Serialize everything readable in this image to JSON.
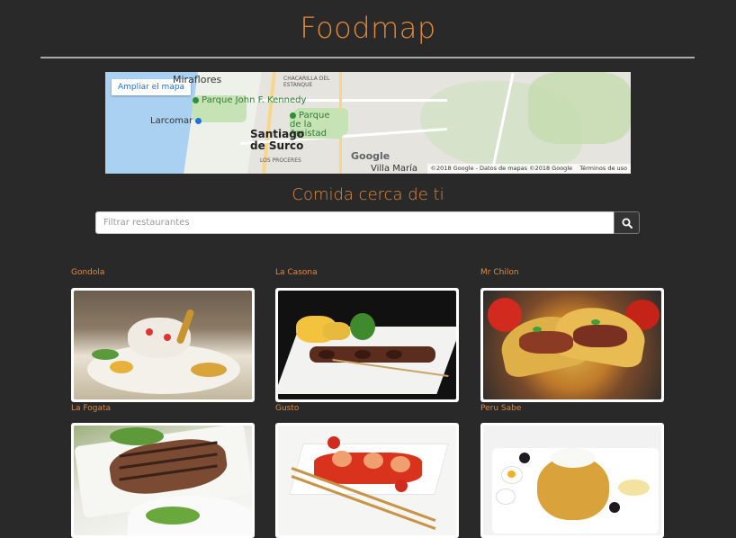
{
  "app": {
    "title": "Foodmap"
  },
  "map": {
    "expand_label": "Ampliar el mapa",
    "places": {
      "miraflores": "Miraflores",
      "chacarilla": "CHACARILLA DEL ESTANQUE",
      "parque_kennedy": "Parque John F. Kennedy",
      "larcomar": "Larcomar",
      "parque_amistad": "Parque de la Amistad",
      "santiago": "Santiago de Surco",
      "los_proceres": "LOS PROCERES",
      "villa_maria": "Villa María"
    },
    "google_logo": "Google",
    "attribution": "©2018 Google - Datos de mapas ©2018 Google",
    "terms": "Términos de uso"
  },
  "section": {
    "subtitle": "Comida cerca de ti"
  },
  "search": {
    "placeholder": "Filtrar restaurantes",
    "icon": "search-icon"
  },
  "restaurants": [
    {
      "name": "Gondola"
    },
    {
      "name": "La Casona"
    },
    {
      "name": "Mr Chilon"
    },
    {
      "name": "La Fogata"
    },
    {
      "name": "Gusto"
    },
    {
      "name": "Peru Sabe"
    }
  ],
  "colors": {
    "background": "#2a2929",
    "accent": "#e08a3c",
    "button": "#333333"
  }
}
